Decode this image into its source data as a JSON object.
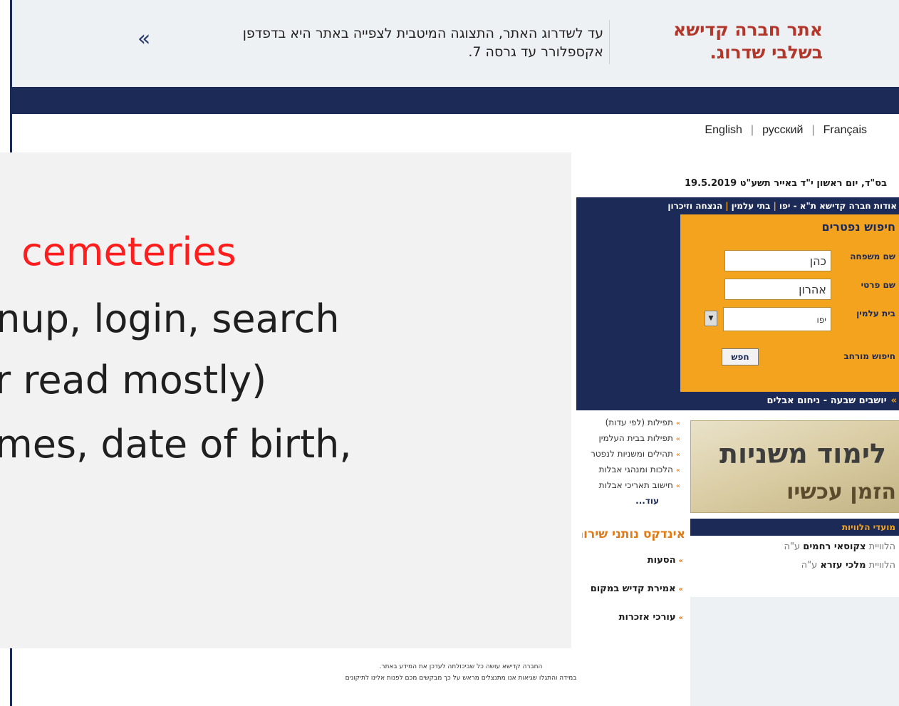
{
  "banner": {
    "site_title": "אתר חברה קדישא בשלבי שדרוג.",
    "message": "עד לשדרוג האתר, התצוגה המיטבית לצפייה באתר היא בדפדפן אקספלורר עד גרסה 7.",
    "arrow": "«"
  },
  "languages": [
    "English",
    "русский",
    "Français"
  ],
  "date_line": "בס\"ד, יום ראשון י\"ד באייר תשע\"ט  19.5.2019",
  "top_menu": {
    "items": [
      "אודות חברה קדישא ת\"א - יפו",
      "בתי עלמין",
      "הנצחה וזיכרון"
    ]
  },
  "search": {
    "title": "חיפוש נפטרים",
    "last_name_label": "שם משפחה",
    "last_name_value": "כהן",
    "first_name_label": "שם פרטי",
    "first_name_value": "אהרון",
    "cemetery_label": "בית עלמין",
    "cemetery_value": "יפו",
    "advanced_label": "חיפוש מורחב",
    "search_button": "חפש"
  },
  "shiva_bar": "יושבים שבעה - ניחום אבלים",
  "links": [
    "תפילות (לפי עדות)",
    "תפילות בבית העלמין",
    "תהילים ומשניות לנפטר",
    "הלכות ומנהגי אבלות",
    "חישוב תאריכי אבלות"
  ],
  "links_more": "עוד...",
  "index_title": "אינדקס נותני שירות",
  "sublinks": [
    "הסעות",
    "אמירת קדיש במקום",
    "עורכי אזכרות"
  ],
  "mishna_banner": {
    "line1": "לימוד משניות",
    "line2": "הזמן עכשיו"
  },
  "funerals": {
    "title": "מועדי הלוויות",
    "items": [
      {
        "prefix": "הלוויית",
        "name": "צקוסאי רחמים",
        "suffix": "ע\"ה"
      },
      {
        "prefix": "הלוויית",
        "name": "מלכי עזרא",
        "suffix": "ע\"ה"
      }
    ]
  },
  "footer_note": [
    "החברה קדישא עושה כל שביכולתה לעדכן את המידע באתר.",
    "במידה והתגלו שגיאות אנו מתנצלים מראש על כך מבקשים מכם לפנות אלינו לתיקונים"
  ],
  "slide": {
    "lines": [
      "cemeteries",
      "gnup, login, search",
      "or read mostly)",
      "ames, date of birth,"
    ],
    "accent_color": "#ff1d1d"
  }
}
